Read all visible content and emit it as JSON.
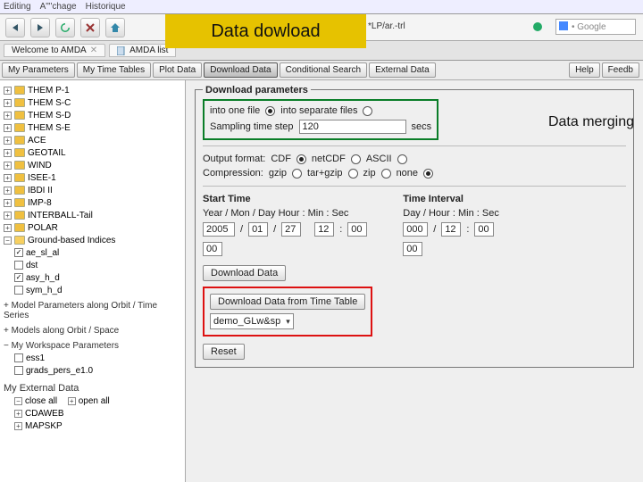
{
  "browser_menu": {
    "editing": "Editing",
    "affichage": "A\"\"chage",
    "historique": "Historique"
  },
  "overlay_title": "Data dowload",
  "url_fragment": "*LP/ar.-trl",
  "search_placeholder": "• Google",
  "tabs": {
    "welcome": "Welcome to AMDA",
    "amda_list": "AMDA  list"
  },
  "menu": {
    "params": "My Parameters",
    "timetables": "My Time Tables",
    "plot": "Plot Data",
    "download": "Download Data",
    "cond": "Conditional Search",
    "ext": "External Data",
    "help": "Help",
    "feed": "Feedb"
  },
  "tree": {
    "items": [
      "THEM P-1",
      "THEM S-C",
      "THEM S-D",
      "THEM S-E",
      "ACE",
      "GEOTAIL",
      "WIND",
      "ISEE-1",
      "IBDI II",
      "IMP-8",
      "INTERBALL-Tail",
      "POLAR"
    ],
    "ground": "Ground-based Indices",
    "derived": [
      "ae_sl_al",
      "dst",
      "asy_h_d",
      "sym_h_d"
    ],
    "model": "Model Parameters along Orbit / Time Series",
    "model2": "Models along Orbit / Space",
    "ws": "My Workspace Parameters",
    "ws_items": [
      "ess1",
      "grads_pers_e1.0"
    ],
    "extdata": "My External Data",
    "closeall": "close all",
    "openall": "open all",
    "ext_items": [
      "CDAWEB",
      "MAPSKP"
    ]
  },
  "dl": {
    "legend": "Download parameters",
    "onefile": "into one file",
    "sepfiles": "into separate files",
    "sampling": "Sampling time step",
    "sampling_val": "120",
    "sampling_unit": "secs",
    "outfmt": "Output format:",
    "fmt_cdf": "CDF",
    "fmt_netcdf": "netCDF",
    "fmt_ascii": "ASCII",
    "compression": "Compression:",
    "c_gzip": "gzip",
    "c_targz": "tar+gzip",
    "c_zip": "zip",
    "c_none": "none"
  },
  "annot_merge": "Data merging",
  "start": {
    "label": "Start Time",
    "sub": "Year / Mon / Day   Hour : Min : Sec",
    "year": "2005",
    "mon": "01",
    "day": "27",
    "hour": "12",
    "min": "00",
    "sec": "00"
  },
  "interval": {
    "label": "Time Interval",
    "sub": "Day / Hour : Min : Sec",
    "day": "000",
    "hour": "12",
    "min": "00",
    "sec": "00"
  },
  "btn_dl": "Download Data",
  "tt_btn": "Download Data from Time Table",
  "tt_select": "demo_GLw&sp",
  "reset": "Reset"
}
